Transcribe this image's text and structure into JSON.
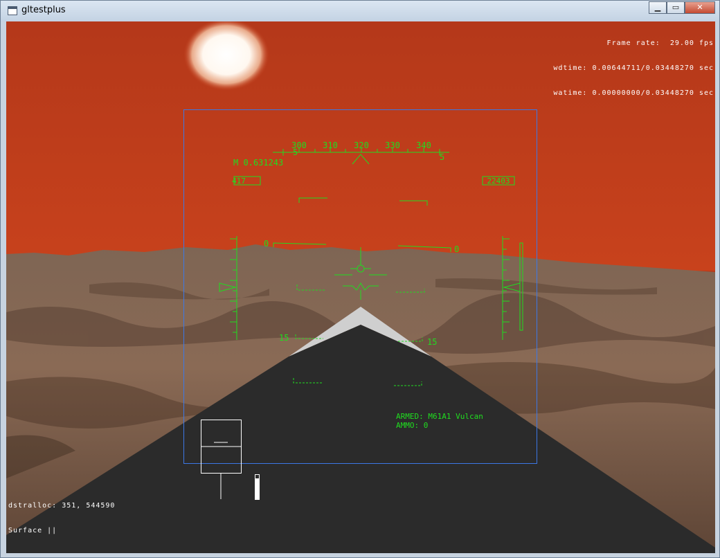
{
  "window": {
    "title": "gltestplus",
    "buttons": {
      "minimize": "▁",
      "maximize": "▭",
      "close": "✕"
    }
  },
  "stats": {
    "frame_rate": "Frame rate:  29.00 fps",
    "wdtime": "wdtime: 0.00644711/0.03448270 sec",
    "watime": "watime: 0.00000000/0.03448270 sec"
  },
  "hud": {
    "mach": "M 0.631243",
    "airspeed": "417",
    "altitude": "22403",
    "heading_ticks": [
      "300",
      "310",
      "320",
      "330",
      "340"
    ],
    "heading_left_marker": "5",
    "heading_right_marker": "5",
    "pitch_labels": {
      "zero_left": "0",
      "zero_right": "0",
      "neg15_left": "15",
      "neg15_right": "15"
    },
    "weapon_armed": "ARMED: M61A1 Vulcan",
    "weapon_ammo": "AMMO: 0",
    "color": "#20dd20",
    "frame_color": "#3c78e6"
  },
  "debug": {
    "line1": "dstralloc: 351, 544590",
    "line2": "Surface ||"
  },
  "colors": {
    "sky": "#b8391a",
    "terrain": "#7a5c48",
    "cockpit": "#2b2b2b",
    "nose_highlight": "#cfcfcf"
  }
}
